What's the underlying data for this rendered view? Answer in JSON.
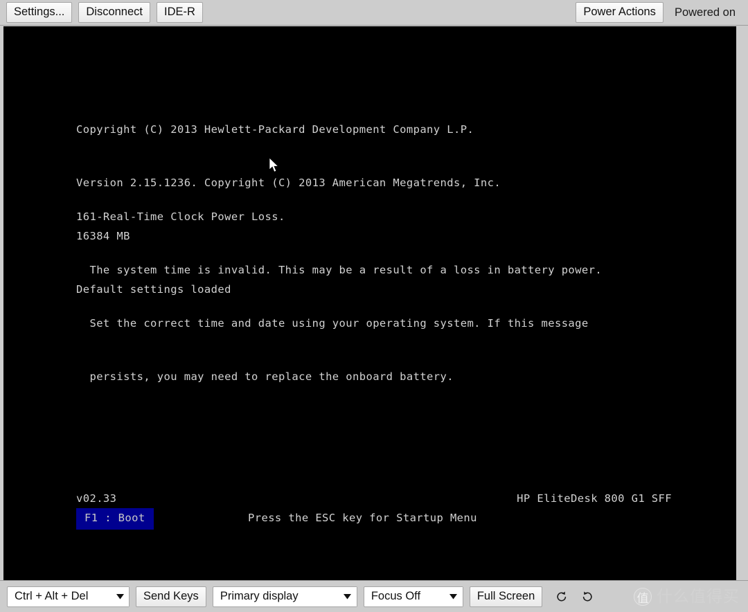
{
  "top_toolbar": {
    "settings_label": "Settings...",
    "disconnect_label": "Disconnect",
    "ider_label": "IDE-R",
    "power_actions_label": "Power Actions",
    "power_status": "Powered on"
  },
  "bios_screen": {
    "header_lines": [
      "Copyright (C) 2013 Hewlett-Packard Development Company L.P.",
      "Version 2.15.1236. Copyright (C) 2013 American Megatrends, Inc.",
      "16384 MB",
      "Default settings loaded"
    ],
    "error_lines": [
      "161-Real-Time Clock Power Loss.",
      "  The system time is invalid. This may be a result of a loss in battery power.",
      "  Set the correct time and date using your operating system. If this message",
      "  persists, you may need to replace the onboard battery."
    ],
    "firmware_version": "v02.33",
    "model_name": "HP EliteDesk 800 G1 SFF",
    "boot_key_label": "F1 : Boot",
    "startup_hint": "Press the ESC key for Startup Menu",
    "text_color": "#d2d2d2",
    "background_color": "#000000",
    "highlight_color": "#000090"
  },
  "bottom_toolbar": {
    "key_combo_value": "Ctrl + Alt + Del",
    "send_keys_label": "Send Keys",
    "display_combo_value": "Primary display",
    "focus_combo_value": "Focus Off",
    "full_screen_label": "Full Screen",
    "rotate_ccw_icon": "rotate-counterclockwise-icon",
    "rotate_cw_icon": "rotate-clockwise-icon"
  },
  "watermark": {
    "badge_char": "值",
    "text": "什么值得买"
  }
}
